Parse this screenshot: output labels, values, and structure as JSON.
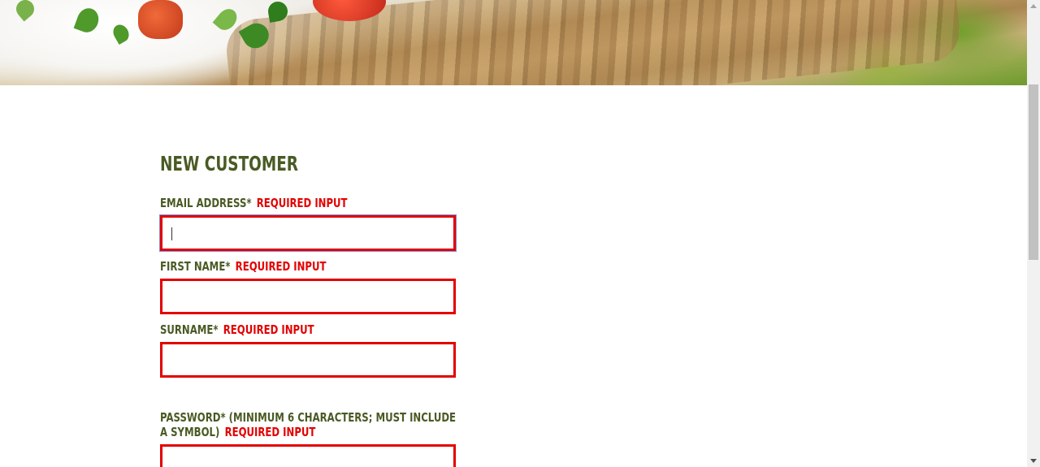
{
  "form": {
    "title": "NEW CUSTOMER",
    "required_text": "REQUIRED INPUT",
    "fields": {
      "email": {
        "label": "EMAIL ADDRESS*",
        "value": ""
      },
      "first_name": {
        "label": "FIRST NAME*",
        "value": ""
      },
      "surname": {
        "label": "SURNAME*",
        "value": ""
      },
      "password": {
        "label": "PASSWORD* (MINIMUM 6 CHARACTERS; MUST INCLUDE A SYMBOL)",
        "value": ""
      }
    }
  },
  "colors": {
    "heading": "#4a5a24",
    "error": "#e30000",
    "background": "#ffffff"
  },
  "hero": {
    "icon": "food-banner-image"
  }
}
